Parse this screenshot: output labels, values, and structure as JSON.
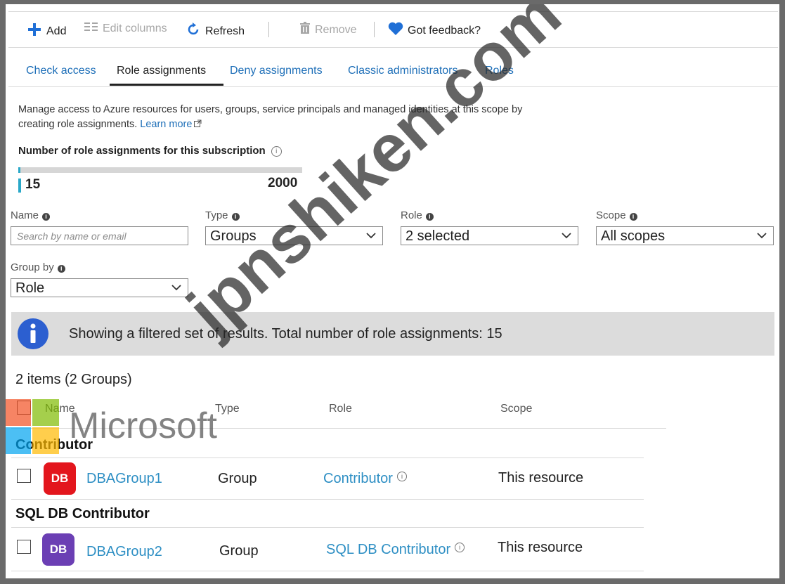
{
  "toolbar": {
    "add": "Add",
    "edit_columns": "Edit columns",
    "refresh": "Refresh",
    "remove": "Remove",
    "feedback": "Got feedback?"
  },
  "tabs": [
    {
      "label": "Check access"
    },
    {
      "label": "Role assignments"
    },
    {
      "label": "Deny assignments"
    },
    {
      "label": "Classic administrators"
    },
    {
      "label": "Roles"
    }
  ],
  "description": {
    "text": "Manage access to Azure resources for users, groups, service principals and managed identities at this scope by creating role assignments.",
    "learn_more": "Learn more"
  },
  "usage": {
    "label": "Number of role assignments for this subscription",
    "current": "15",
    "max": "2000",
    "fraction": 0.0075
  },
  "filters": {
    "name": {
      "label": "Name",
      "placeholder": "Search by name or email"
    },
    "type": {
      "label": "Type",
      "value": "Groups"
    },
    "role": {
      "label": "Role",
      "value": "2 selected"
    },
    "scope": {
      "label": "Scope",
      "value": "All scopes"
    },
    "group_by": {
      "label": "Group by",
      "value": "Role"
    }
  },
  "banner": {
    "text": "Showing a filtered set of results. Total number of role assignments: 15"
  },
  "results": {
    "count_text": "2 items (2 Groups)",
    "headers": {
      "name": "Name",
      "type": "Type",
      "role": "Role",
      "scope": "Scope"
    },
    "groups": [
      {
        "title": "Contributor",
        "rows": [
          {
            "avatar": "DB",
            "avatar_color": "#e3161d",
            "name": "DBAGroup1",
            "type": "Group",
            "role": "Contributor",
            "scope": "This resource"
          }
        ]
      },
      {
        "title": "SQL DB Contributor",
        "rows": [
          {
            "avatar": "DB",
            "avatar_color": "#6b3fb4",
            "name": "DBAGroup2",
            "type": "Group",
            "role": "SQL DB Contributor",
            "scope": "This resource"
          }
        ]
      }
    ]
  },
  "watermark": {
    "site": "jpnshiken.com",
    "brand": "Microsoft"
  },
  "colors": {
    "link": "#1e6fb8",
    "accent_bar": "#29a8c8",
    "banner_bg": "#dcdcdc",
    "info_icon": "#2c5fd0",
    "heart": "#1f6fd6"
  }
}
